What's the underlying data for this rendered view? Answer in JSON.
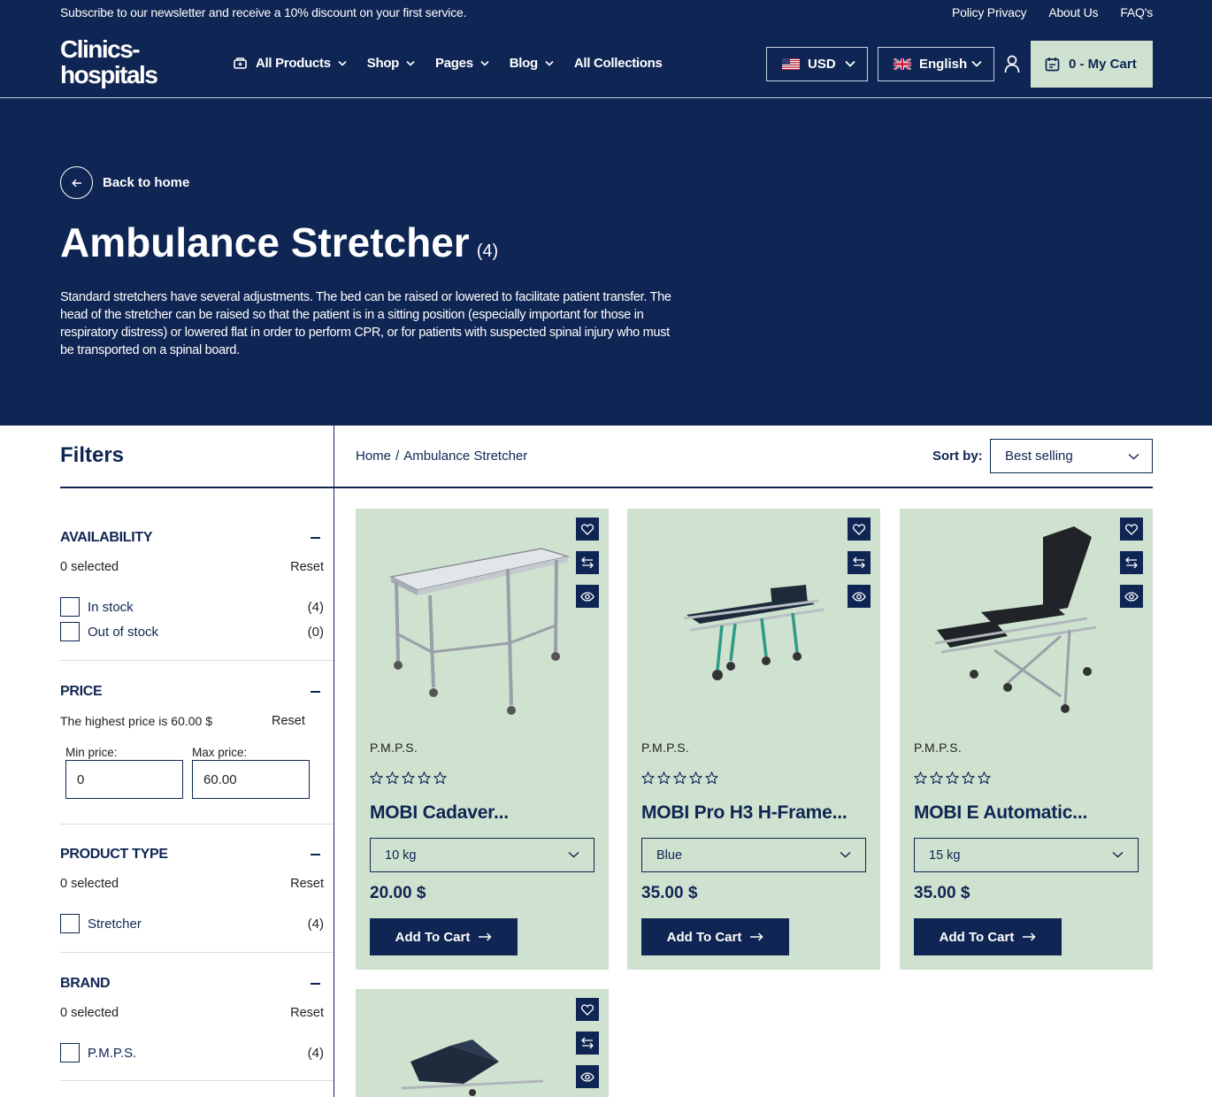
{
  "topbar": {
    "promo": "Subscribe to our newsletter and receive a 10% discount on your first service.",
    "links": [
      "Policy Privacy",
      "About Us",
      "FAQ's"
    ]
  },
  "header": {
    "logo_line1": "Clinics-",
    "logo_line2": "hospitals",
    "nav": [
      "All Products",
      "Shop",
      "Pages",
      "Blog",
      "All Collections"
    ],
    "currency": "USD",
    "language": "English",
    "cart_label": "0 - My Cart"
  },
  "hero": {
    "back_label": "Back to home",
    "title": "Ambulance Stretcher",
    "count": "(4)",
    "description": "Standard stretchers have several adjustments. The bed can be raised or lowered to facilitate patient transfer. The head of the stretcher can be raised so that the patient is in a sitting position (especially important for those in respiratory distress) or lowered flat in order to perform CPR, or for patients with suspected spinal injury who must be transported on a spinal board."
  },
  "filters": {
    "title": "Filters",
    "availability": {
      "heading": "AVAILABILITY",
      "selected": "0 selected",
      "reset": "Reset",
      "options": [
        {
          "label": "In stock",
          "count": "(4)"
        },
        {
          "label": "Out of stock",
          "count": "(0)"
        }
      ]
    },
    "price": {
      "heading": "PRICE",
      "note": "The highest price is 60.00 $",
      "reset": "Reset",
      "min_label": "Min price:",
      "max_label": "Max price:",
      "min_value": "0",
      "max_value": "60.00"
    },
    "product_type": {
      "heading": "PRODUCT TYPE",
      "selected": "0 selected",
      "reset": "Reset",
      "options": [
        {
          "label": "Stretcher",
          "count": "(4)"
        }
      ]
    },
    "brand": {
      "heading": "BRAND",
      "selected": "0 selected",
      "reset": "Reset",
      "options": [
        {
          "label": "P.M.P.S.",
          "count": "(4)"
        }
      ]
    }
  },
  "breadcrumb": {
    "home": "Home",
    "sep": "/",
    "current": "Ambulance Stretcher"
  },
  "sort": {
    "label": "Sort by:",
    "value": "Best selling"
  },
  "products": [
    {
      "brand": "P.M.P.S.",
      "name": "MOBI Cadaver...",
      "variant": "10 kg",
      "price": "20.00 $",
      "cta": "Add To Cart",
      "rating": 0
    },
    {
      "brand": "P.M.P.S.",
      "name": "MOBI Pro H3 H-Frame...",
      "variant": "Blue",
      "price": "35.00 $",
      "cta": "Add To Cart",
      "rating": 0
    },
    {
      "brand": "P.M.P.S.",
      "name": "MOBI E Automatic...",
      "variant": "15 kg",
      "price": "35.00 $",
      "cta": "Add To Cart",
      "rating": 0
    }
  ],
  "colors": {
    "navy": "#0f2553",
    "mint": "#cfe2cf",
    "white": "#ffffff"
  }
}
